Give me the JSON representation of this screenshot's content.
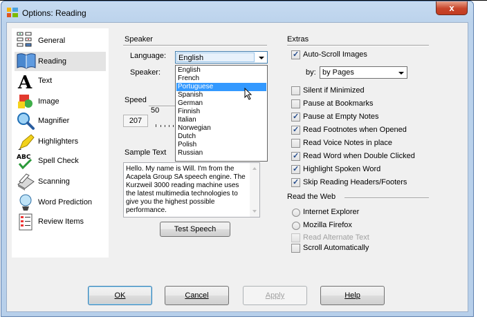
{
  "window": {
    "title": "Options: Reading",
    "close_glyph": "x"
  },
  "sidebar": {
    "items": [
      {
        "label": "General",
        "icon": "general-icon"
      },
      {
        "label": "Reading",
        "icon": "reading-icon"
      },
      {
        "label": "Text",
        "icon": "text-icon"
      },
      {
        "label": "Image",
        "icon": "image-icon"
      },
      {
        "label": "Magnifier",
        "icon": "magnifier-icon"
      },
      {
        "label": "Highlighters",
        "icon": "highlighter-icon"
      },
      {
        "label": "Spell Check",
        "icon": "spell-check-icon"
      },
      {
        "label": "Scanning",
        "icon": "scanner-icon"
      },
      {
        "label": "Word Prediction",
        "icon": "word-prediction-icon"
      },
      {
        "label": "Review Items",
        "icon": "review-items-icon"
      }
    ],
    "selected": "Reading"
  },
  "speaker": {
    "group_title": "Speaker",
    "language_label": "Language:",
    "language_value": "English",
    "speaker_label": "Speaker:",
    "language_options": [
      "English",
      "French",
      "Portuguese",
      "Spanish",
      "German",
      "Finnish",
      "Italian",
      "Norwegian",
      "Dutch",
      "Polish",
      "Russian"
    ],
    "highlighted_option": "Portuguese"
  },
  "speed": {
    "group_title": "Speed",
    "value": "207",
    "tick_label": "50"
  },
  "sample": {
    "group_title": "Sample Text",
    "text": "Hello. My name is Will. I'm from the Acapela Group SA speech engine. The Kurzweil 3000 reading machine uses the latest multimedia technologies to give you the highest possible performance.",
    "test_button": "Test Speech"
  },
  "extras": {
    "group_title": "Extras",
    "auto_scroll": {
      "label": "Auto-Scroll Images",
      "checked": true
    },
    "by_label": "by:",
    "by_value": "by Pages",
    "checkboxes": [
      {
        "label": "Silent if Minimized",
        "checked": false
      },
      {
        "label": "Pause at Bookmarks",
        "checked": false
      },
      {
        "label": "Pause at Empty Notes",
        "checked": true
      },
      {
        "label": "Read Footnotes when Opened",
        "checked": true
      },
      {
        "label": "Read Voice Notes in place",
        "checked": false
      },
      {
        "label": "Read Word when Double Clicked",
        "checked": true
      },
      {
        "label": "Highlight Spoken Word",
        "checked": true
      },
      {
        "label": "Skip Reading Headers/Footers",
        "checked": true
      }
    ]
  },
  "web": {
    "group_title": "Read the Web",
    "radios": [
      {
        "label": "Internet Explorer"
      },
      {
        "label": "Mozilla Firefox"
      }
    ],
    "read_alternate": {
      "label": "Read Alternate Text",
      "disabled": true
    },
    "scroll_auto": {
      "label": "Scroll Automatically",
      "checked": false
    }
  },
  "buttons": {
    "ok": "OK",
    "cancel": "Cancel",
    "apply": "Apply",
    "help": "Help"
  },
  "colors": {
    "selection": "#3399ff",
    "title_bar": "#bcd3ec",
    "close_button": "#c8452a"
  }
}
